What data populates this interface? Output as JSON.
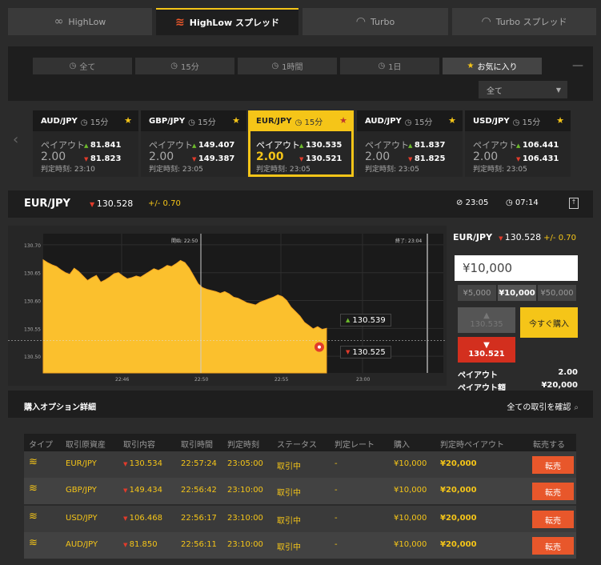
{
  "top_tabs": [
    {
      "label": "HighLow",
      "icon": "link-icon"
    },
    {
      "label": "HighLow スプレッド",
      "icon": "wave-icon",
      "active": true
    },
    {
      "label": "Turbo",
      "icon": "gauge-icon"
    },
    {
      "label": "Turbo スプレッド",
      "icon": "gauge-icon"
    }
  ],
  "filters": {
    "items": [
      {
        "label": "全て"
      },
      {
        "label": "15分"
      },
      {
        "label": "1時間"
      },
      {
        "label": "1日"
      },
      {
        "label": "お気に入り",
        "active": true
      }
    ],
    "select_value": "全て"
  },
  "cards": [
    {
      "pair": "AUD/JPY",
      "tf": "15分",
      "label": "ペイアウト",
      "payout": "2.00",
      "up": "81.841",
      "dn": "81.823",
      "judge": "判定時刻: 23:10"
    },
    {
      "pair": "GBP/JPY",
      "tf": "15分",
      "label": "ペイアウト",
      "payout": "2.00",
      "up": "149.407",
      "dn": "149.387",
      "judge": "判定時刻: 23:05"
    },
    {
      "pair": "EUR/JPY",
      "tf": "15分",
      "label": "ペイアウト",
      "payout": "2.00",
      "up": "130.535",
      "dn": "130.521",
      "judge": "判定時刻: 23:05",
      "active": true
    },
    {
      "pair": "AUD/JPY",
      "tf": "15分",
      "label": "ペイアウト",
      "payout": "2.00",
      "up": "81.837",
      "dn": "81.825",
      "judge": "判定時刻: 23:05"
    },
    {
      "pair": "USD/JPY",
      "tf": "15分",
      "label": "ペイアウト",
      "payout": "2.00",
      "up": "106.441",
      "dn": "106.431",
      "judge": "判定時刻: 23:05"
    }
  ],
  "pair_bar": {
    "name": "EUR/JPY",
    "rate": "130.528",
    "change": "+/- 0.70",
    "judge_time": "23:05",
    "remaining": "07:14"
  },
  "chart_data": {
    "type": "area",
    "title": "",
    "xlabel": "",
    "ylabel": "",
    "y_ticks": [
      "130.70",
      "130.65",
      "130.60",
      "130.55",
      "130.50"
    ],
    "x_ticks": [
      "22:46",
      "22:50",
      "22:55",
      "23:00"
    ],
    "ylim": [
      130.47,
      130.72
    ],
    "start_label": "開始: 22:50",
    "end_label": "終了: 23:04",
    "current_rate": 130.528,
    "ask": "130.539",
    "bid": "130.525",
    "series": [
      {
        "values": [
          130.673,
          130.668,
          130.664,
          130.661,
          130.655,
          130.65,
          130.647,
          130.658,
          130.652,
          130.644,
          130.636,
          130.641,
          130.645,
          130.633,
          130.637,
          130.642,
          130.648,
          130.65,
          130.644,
          130.639,
          130.641,
          130.644,
          130.642,
          130.647,
          130.652,
          130.657,
          130.654,
          130.658,
          130.663,
          130.661,
          130.666,
          130.672,
          130.668,
          130.658,
          130.644,
          130.63,
          130.623,
          130.62,
          130.618,
          130.616,
          130.613,
          130.616,
          130.612,
          130.606,
          130.604,
          130.6,
          130.596,
          130.594,
          130.592,
          130.597,
          130.6,
          130.603,
          130.606,
          130.61,
          130.607,
          130.6,
          130.588,
          130.58,
          130.572,
          130.561,
          130.555,
          130.549,
          130.553,
          130.548,
          130.55
        ]
      }
    ]
  },
  "trade": {
    "pair": "EUR/JPY",
    "rate": "130.528",
    "change": "+/- 0.70",
    "amount": "¥10,000",
    "presets": [
      "¥5,000",
      "¥10,000",
      "¥50,000"
    ],
    "high_price": "130.535",
    "low_price": "130.521",
    "buy_now": "今すぐ購入",
    "payout_label": "ペイアウト",
    "payout_value": "2.00",
    "payout_amount_label": "ペイアウト額",
    "payout_amount_value": "¥20,000"
  },
  "details": {
    "title": "購入オプション詳細",
    "all_link": "全ての取引を確認",
    "headers": [
      "タイプ",
      "取引原資産",
      "取引内容",
      "取引時間",
      "判定時刻",
      "ステータス",
      "判定レート",
      "購入",
      "判定時ペイアウト",
      "転売する"
    ],
    "rows": [
      {
        "asset": "EUR/JPY",
        "rate": "130.534",
        "time": "22:57:24",
        "judge": "23:05:00",
        "status": "取引中",
        "jrate": "-",
        "buy": "¥10,000",
        "payout": "¥20,000",
        "action": "転売"
      },
      {
        "asset": "GBP/JPY",
        "rate": "149.434",
        "time": "22:56:42",
        "judge": "23:10:00",
        "status": "取引中",
        "jrate": "-",
        "buy": "¥10,000",
        "payout": "¥20,000",
        "action": "転売"
      },
      {
        "asset": "USD/JPY",
        "rate": "106.468",
        "time": "22:56:17",
        "judge": "23:10:00",
        "status": "取引中",
        "jrate": "-",
        "buy": "¥10,000",
        "payout": "¥20,000",
        "action": "転売"
      },
      {
        "asset": "AUD/JPY",
        "rate": "81.850",
        "time": "22:56:11",
        "judge": "23:10:00",
        "status": "取引中",
        "jrate": "-",
        "buy": "¥10,000",
        "payout": "¥20,000",
        "action": "転売"
      }
    ]
  }
}
